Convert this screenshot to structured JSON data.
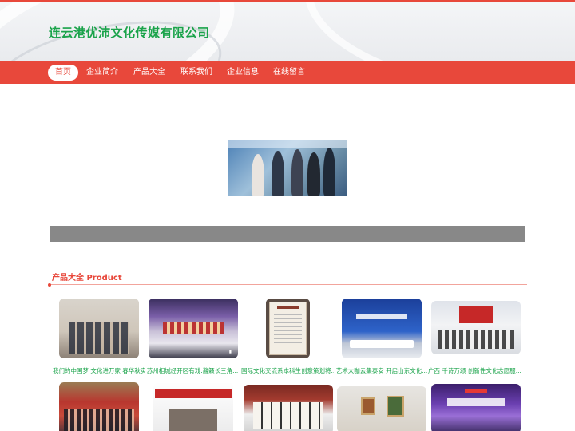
{
  "header": {
    "site_title": "连云港优沛文化传媒有限公司"
  },
  "nav": {
    "items": [
      {
        "label": "首页",
        "active": true
      },
      {
        "label": "企业简介"
      },
      {
        "label": "产品大全"
      },
      {
        "label": "联系我们"
      },
      {
        "label": "企业信息"
      },
      {
        "label": "在线留言"
      }
    ]
  },
  "section": {
    "title": "产品大全 Product"
  },
  "products": [
    {
      "caption": "我们的中国梦 文化进万家 春华秋实..."
    },
    {
      "caption": "苏州相城经开区有戏.酱籁长三角..."
    },
    {
      "caption": "国际文化交流系本科生创意策划将..."
    },
    {
      "caption": "艺术大咖云集泰安 开启山东文化..."
    },
    {
      "caption": "广西 千诗万颂 创新性文化志愿服..."
    },
    {
      "caption": ""
    },
    {
      "caption": ""
    },
    {
      "caption": ""
    },
    {
      "caption": ""
    },
    {
      "caption": ""
    }
  ],
  "colors": {
    "accent": "#e8483b",
    "title_green": "#1aa34a"
  }
}
